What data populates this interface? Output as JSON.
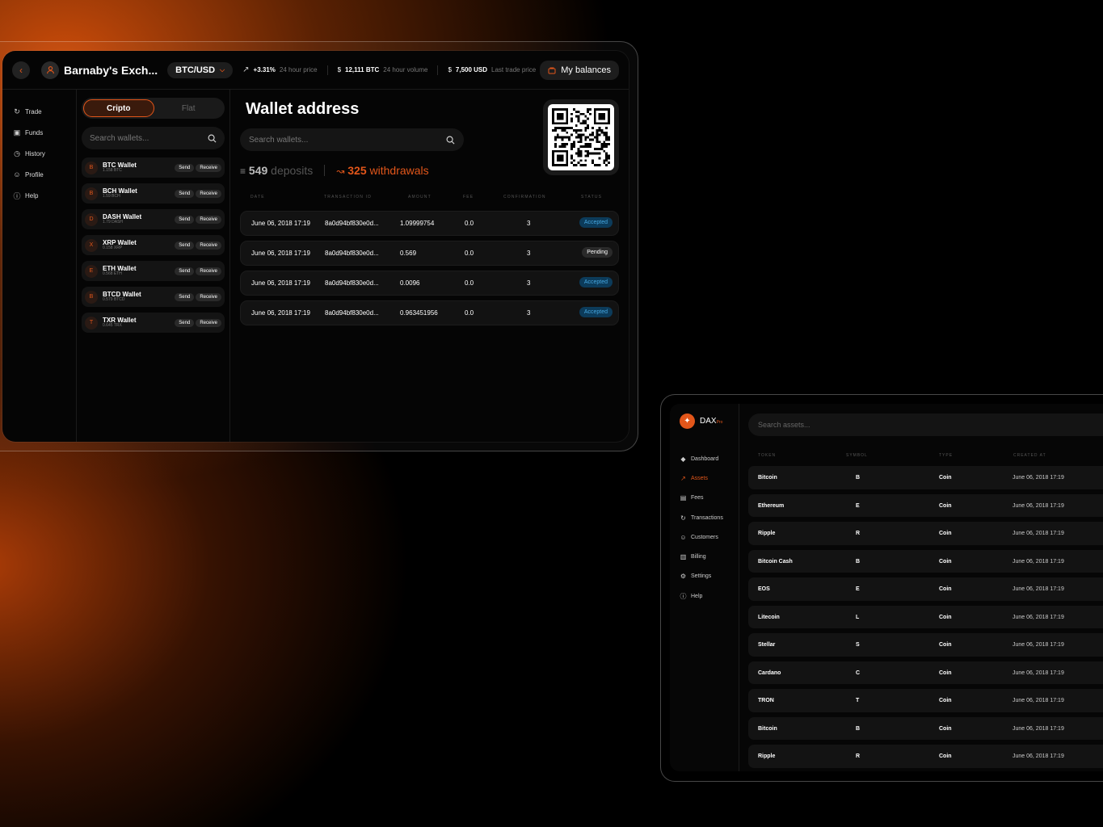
{
  "exchange": {
    "name": "Barnaby's Exch...",
    "pair": "BTC/USD",
    "stats": [
      {
        "value": "+3.31%",
        "label": "24 hour price",
        "prefix": ""
      },
      {
        "value": "12,111 BTC",
        "label": "24 hour volume",
        "prefix": "$"
      },
      {
        "value": "7,500 USD",
        "label": "Last trade price",
        "prefix": "$"
      }
    ],
    "balances_label": "My balances",
    "nav": [
      "Trade",
      "Funds",
      "History",
      "Profile",
      "Help"
    ],
    "tabs": {
      "crypto": "Cripto",
      "fiat": "Flat"
    },
    "wallet_search_placeholder": "Search wallets...",
    "send_label": "Send",
    "receive_label": "Receive",
    "wallets": [
      {
        "letter": "B",
        "name": "BTC Wallet",
        "amount": "1.158 BTC"
      },
      {
        "letter": "B",
        "name": "BCH Wallet",
        "amount": "1.59 BCH"
      },
      {
        "letter": "D",
        "name": "DASH Wallet",
        "amount": "1.79 DASH"
      },
      {
        "letter": "X",
        "name": "XRP Wallet",
        "amount": "0.158 XRP"
      },
      {
        "letter": "E",
        "name": "ETH Wallet",
        "amount": "0.568 ETH"
      },
      {
        "letter": "B",
        "name": "BTCD Wallet",
        "amount": "0.579 BTCD"
      },
      {
        "letter": "T",
        "name": "TXR Wallet",
        "amount": "0.645 TRX"
      }
    ],
    "wallet_title": "Wallet address",
    "search_placeholder": "Search wallets...",
    "deposits_count": "549",
    "deposits_label": "deposits",
    "withdrawals_count": "325",
    "withdrawals_label": "withdrawals",
    "table_headers": [
      "DATE",
      "TRANSACTION ID",
      "AMOUNT",
      "FEE",
      "CONFIRMATION",
      "STATUS"
    ],
    "transactions": [
      {
        "date": "June 06, 2018 17:19",
        "id": "8a0d94bf830e0d...",
        "amount": "1.09999754",
        "fee": "0.0",
        "confirmation": "3",
        "status": "Accepted"
      },
      {
        "date": "June 06, 2018 17:19",
        "id": "8a0d94bf830e0d...",
        "amount": "0.569",
        "fee": "0.0",
        "confirmation": "3",
        "status": "Pending"
      },
      {
        "date": "June 06, 2018 17:19",
        "id": "8a0d94bf830e0d...",
        "amount": "0.0096",
        "fee": "0.0",
        "confirmation": "3",
        "status": "Accepted"
      },
      {
        "date": "June 06, 2018 17:19",
        "id": "8a0d94bf830e0d...",
        "amount": "0.963451956",
        "fee": "0.0",
        "confirmation": "3",
        "status": "Accepted"
      }
    ]
  },
  "dax": {
    "logo_text": "DAX",
    "logo_sub": "Pro",
    "nav": [
      {
        "label": "Dashboard",
        "active": false
      },
      {
        "label": "Assets",
        "active": true
      },
      {
        "label": "Fees",
        "active": false
      },
      {
        "label": "Transactions",
        "active": false
      },
      {
        "label": "Customers",
        "active": false
      },
      {
        "label": "Billing",
        "active": false
      },
      {
        "label": "Settings",
        "active": false
      },
      {
        "label": "Help",
        "active": false
      }
    ],
    "search_placeholder": "Search assets...",
    "table_headers": [
      "TOKEN",
      "SYMBOL",
      "TYPE",
      "CREATED AT"
    ],
    "assets": [
      {
        "token": "Bitcoin",
        "symbol": "B",
        "type": "Coin",
        "created": "June 06, 2018 17:19"
      },
      {
        "token": "Ethereum",
        "symbol": "E",
        "type": "Coin",
        "created": "June 06, 2018 17:19"
      },
      {
        "token": "Ripple",
        "symbol": "R",
        "type": "Coin",
        "created": "June 06, 2018 17:19"
      },
      {
        "token": "Bitcoin Cash",
        "symbol": "B",
        "type": "Coin",
        "created": "June 06, 2018 17:19"
      },
      {
        "token": "EOS",
        "symbol": "E",
        "type": "Coin",
        "created": "June 06, 2018 17:19"
      },
      {
        "token": "Litecoin",
        "symbol": "L",
        "type": "Coin",
        "created": "June 06, 2018 17:19"
      },
      {
        "token": "Stellar",
        "symbol": "S",
        "type": "Coin",
        "created": "June 06, 2018 17:19"
      },
      {
        "token": "Cardano",
        "symbol": "C",
        "type": "Coin",
        "created": "June 06, 2018 17:19"
      },
      {
        "token": "TRON",
        "symbol": "T",
        "type": "Coin",
        "created": "June 06, 2018 17:19"
      },
      {
        "token": "Bitcoin",
        "symbol": "B",
        "type": "Coin",
        "created": "June 06, 2018 17:19"
      },
      {
        "token": "Ripple",
        "symbol": "R",
        "type": "Coin",
        "created": "June 06, 2018 17:19"
      }
    ]
  },
  "colors": {
    "accent": "#e2561a",
    "accepted_bg": "#0c3b5a",
    "accepted_text": "#45a7e0"
  }
}
